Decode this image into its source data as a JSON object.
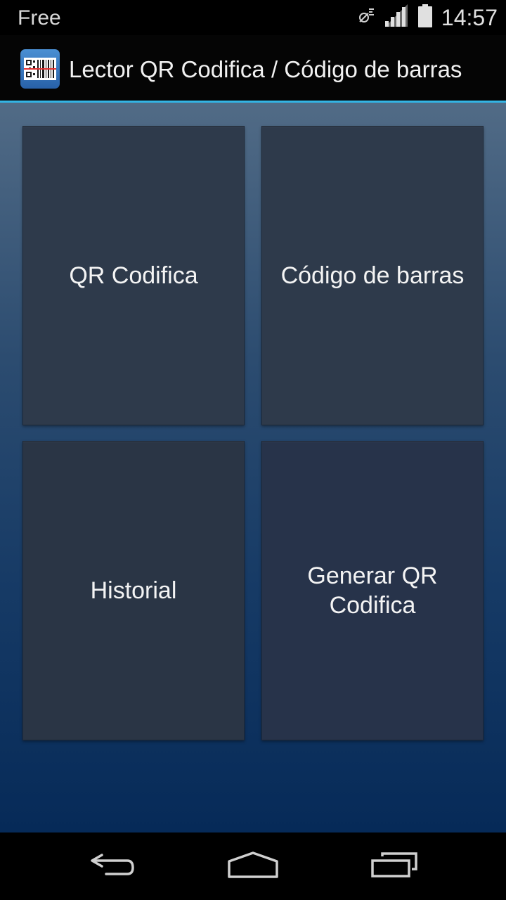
{
  "status_bar": {
    "carrier": "Free",
    "time": "14:57",
    "icons": [
      "sync-disabled-icon",
      "signal-icon",
      "battery-icon"
    ]
  },
  "action_bar": {
    "app_icon": "qr-barcode-app-icon",
    "title": "Lector QR Codifica / Código de barras"
  },
  "menu": {
    "tiles": [
      {
        "label": "QR Codifica"
      },
      {
        "label": "Código de barras"
      },
      {
        "label": "Historial"
      },
      {
        "label": "Generar QR Codifica"
      }
    ]
  },
  "nav_bar": {
    "buttons": [
      "back-icon",
      "home-icon",
      "recent-apps-icon"
    ]
  },
  "colors": {
    "accent_divider": "#33b5e5",
    "tile_bg": "#2e3a4b",
    "text": "#f4f4f4"
  }
}
